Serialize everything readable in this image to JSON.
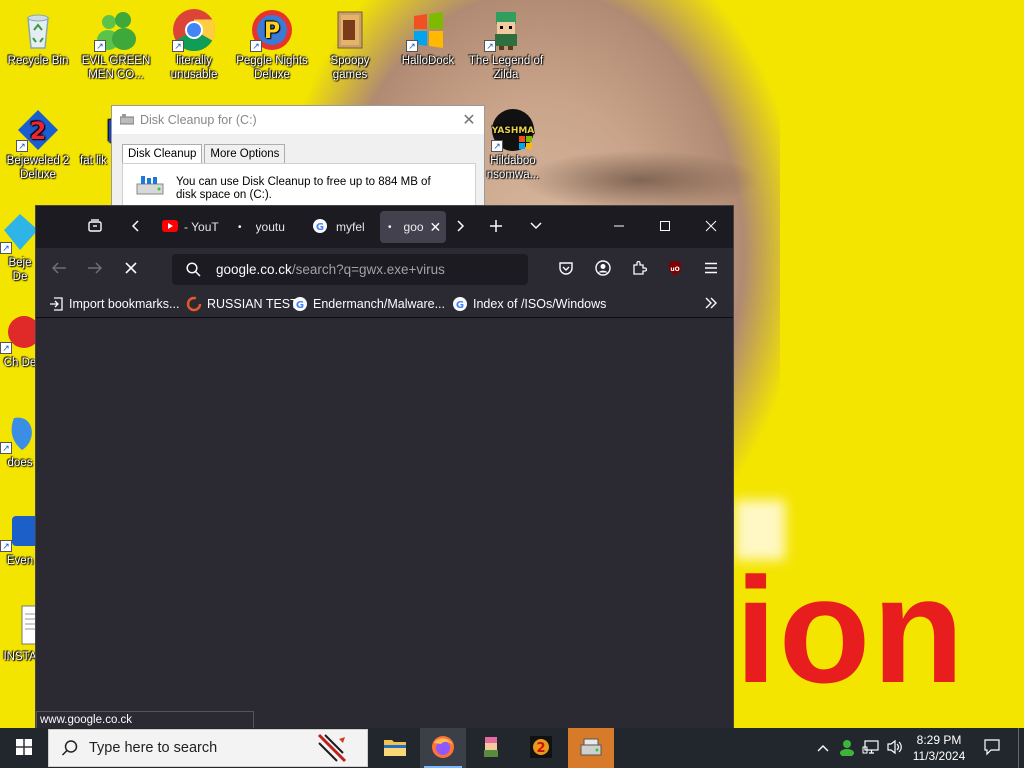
{
  "desktop": {
    "icons": [
      {
        "label": "Recycle Bin",
        "icon": "recycle-bin-icon"
      },
      {
        "label": "EVIL GREEN MEN CO...",
        "icon": "green-men-icon"
      },
      {
        "label": "literally unusable",
        "icon": "chrome-icon"
      },
      {
        "label": "Peggle Nights Deluxe",
        "icon": "peggle-icon"
      },
      {
        "label": "Spoopy games",
        "icon": "folder-icon"
      },
      {
        "label": "HalloDock",
        "icon": "windows-logo-icon"
      },
      {
        "label": "The Legend of Zilda",
        "icon": "zilda-icon"
      },
      {
        "label": "Bejeweled 2 Deluxe",
        "icon": "bejeweled-icon"
      },
      {
        "label": "fat lik",
        "icon": "fat-icon"
      },
      {
        "label": "Hildaboo nsomwa...",
        "icon": "yashma-icon"
      },
      {
        "label": "Beje De",
        "icon": "diamond-icon"
      },
      {
        "label": "Ch De",
        "icon": "red-ball-icon"
      },
      {
        "label": "does",
        "icon": "blue-shape-icon"
      },
      {
        "label": "Even",
        "icon": "blue-app-icon"
      },
      {
        "label": "INSTA",
        "icon": "document-icon"
      }
    ],
    "wallpaper_text": "ion"
  },
  "disk_cleanup": {
    "title": "Disk Cleanup for  (C:)",
    "tabs": [
      "Disk Cleanup",
      "More Options"
    ],
    "message": "You can use Disk Cleanup to free up to 884 MB of disk space on  (C:)."
  },
  "firefox": {
    "tabs": [
      {
        "title": "- YouT",
        "icon": "youtube-icon",
        "active": false
      },
      {
        "title": "youtu",
        "icon": "dot-icon",
        "active": false
      },
      {
        "title": "myfel",
        "icon": "google-icon",
        "active": false
      },
      {
        "title": "goo",
        "icon": "dot-icon",
        "active": true
      }
    ],
    "url_host": "google.co.ck",
    "url_path": "/search?q=gwx.exe+virus",
    "bookmarks": [
      {
        "label": "Import bookmarks...",
        "icon": "import-icon"
      },
      {
        "label": "RUSSIAN TEST",
        "icon": "russian-test-icon"
      },
      {
        "label": "Endermanch/Malware...",
        "icon": "google-icon"
      },
      {
        "label": "Index of /ISOs/Windows",
        "icon": "google-icon"
      }
    ],
    "status_url": "www.google.co.ck"
  },
  "taskbar": {
    "search_placeholder": "Type here to search",
    "time": "8:29 PM",
    "date": "11/3/2024"
  },
  "colors": {
    "firefox_bg": "#2b2a33",
    "tabbar_bg": "#1c1b22",
    "taskbar_bg": "#22262d",
    "wallpaper_yellow": "#f4e500",
    "wallpaper_red_text": "#e81d1d"
  }
}
